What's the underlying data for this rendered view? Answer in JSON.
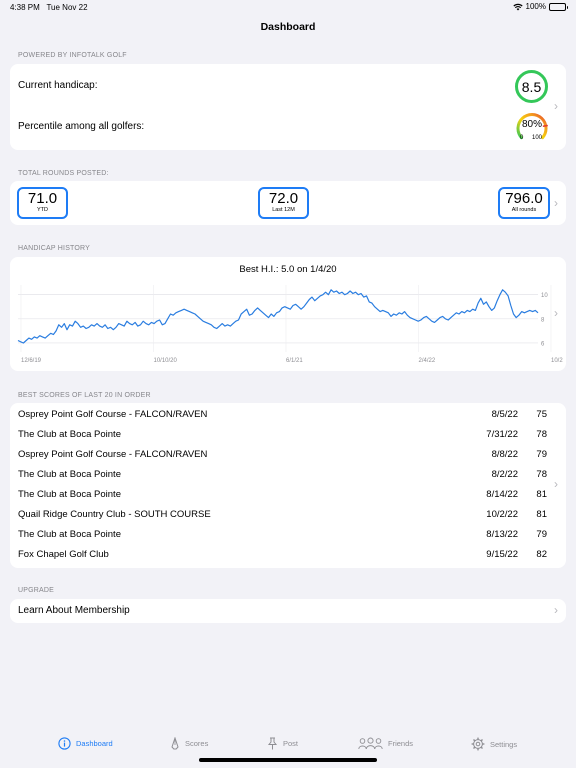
{
  "status_bar": {
    "time": "4:38 PM",
    "date": "Tue Nov 22",
    "battery": "100%"
  },
  "nav": {
    "title": "Dashboard"
  },
  "handicap_section": {
    "header": "POWERED BY INFOTALK GOLF",
    "current_label": "Current handicap:",
    "current_value": "8.5",
    "percentile_label": "Percentile among all golfers:",
    "percentile_value": "80%",
    "percentile_fraction": 0.8,
    "gauge_min": "0",
    "gauge_max": "100"
  },
  "rounds_section": {
    "header": "TOTAL ROUNDS POSTED:",
    "boxes": [
      {
        "value": "71.0",
        "label": "YTD"
      },
      {
        "value": "72.0",
        "label": "Last 12M"
      },
      {
        "value": "796.0",
        "label": "All rounds"
      }
    ]
  },
  "history_section": {
    "header": "HANDICAP HISTORY"
  },
  "chart_data": {
    "type": "line",
    "title": "Best H.I.: 5.0 on 1/4/20",
    "x_ticks": [
      "12/6/19",
      "10/10/20",
      "6/1/21",
      "2/4/22",
      "10/2"
    ],
    "y_ticks": [
      "10",
      "8",
      "6"
    ],
    "ylim": [
      5.5,
      10.8
    ],
    "grid": "horizontal",
    "series": [
      {
        "values": [
          6.2,
          6.1,
          6.0,
          6.2,
          6.4,
          6.3,
          6.5,
          6.4,
          6.6,
          6.5,
          6.4,
          6.6,
          6.8,
          6.7,
          7.0,
          7.5,
          7.3,
          7.6,
          7.1,
          7.5,
          7.4,
          7.8,
          7.6,
          7.3,
          7.4,
          7.2,
          7.3,
          7.5,
          7.4,
          7.6,
          7.4,
          7.3,
          7.5,
          7.2,
          7.3,
          7.1,
          7.3,
          7.6,
          7.5,
          7.4,
          7.8,
          7.6,
          7.5,
          7.7,
          7.4,
          7.5,
          7.8,
          7.6,
          7.5,
          7.7,
          7.6,
          7.8,
          7.9,
          7.5,
          7.6,
          8.0,
          8.4,
          8.3,
          8.5,
          8.6,
          8.7,
          8.8,
          8.7,
          8.6,
          8.5,
          8.4,
          8.2,
          8.0,
          7.8,
          7.7,
          7.6,
          7.5,
          7.3,
          7.2,
          7.4,
          7.6,
          7.4,
          7.5,
          7.4,
          7.6,
          7.8,
          7.9,
          8.4,
          8.6,
          8.8,
          8.3,
          8.4,
          8.7,
          8.9,
          8.7,
          8.5,
          8.3,
          8.1,
          8.4,
          8.2,
          8.5,
          8.6,
          8.9,
          9.0,
          8.9,
          8.8,
          9.1,
          9.2,
          9.0,
          8.8,
          9.0,
          9.3,
          9.6,
          9.8,
          9.5,
          9.7,
          9.9,
          10.0,
          10.2,
          10.0,
          10.4,
          10.2,
          10.3,
          10.1,
          10.2,
          10.0,
          10.1,
          10.3,
          10.1,
          10.2,
          10.0,
          10.1,
          9.8,
          9.9,
          9.4,
          9.3,
          9.0,
          8.8,
          8.6,
          8.7,
          8.6,
          8.5,
          8.2,
          8.4,
          8.3,
          8.5,
          8.4,
          8.6,
          8.3,
          8.1,
          8.0,
          7.9,
          7.8,
          7.9,
          8.1,
          8.2,
          8.0,
          7.8,
          7.7,
          7.9,
          8.1,
          8.2,
          8.0,
          7.9,
          8.1,
          8.3,
          8.5,
          8.4,
          8.6,
          8.5,
          8.7,
          8.6,
          8.8,
          8.7,
          9.3,
          9.7,
          9.2,
          9.4,
          9.0,
          8.7,
          8.9,
          9.5,
          10.0,
          10.4,
          10.2,
          9.9,
          9.1,
          8.4,
          8.1,
          8.3,
          8.6,
          8.5,
          8.6,
          8.7,
          8.6,
          8.7,
          8.5
        ]
      }
    ]
  },
  "scores_section": {
    "header": "BEST SCORES OF LAST 20 IN ORDER",
    "rows": [
      {
        "course": "Osprey Point Golf Course - FALCON/RAVEN",
        "date": "8/5/22",
        "score": "75"
      },
      {
        "course": "The Club at Boca Pointe",
        "date": "7/31/22",
        "score": "78"
      },
      {
        "course": "Osprey Point Golf Course - FALCON/RAVEN",
        "date": "8/8/22",
        "score": "79"
      },
      {
        "course": "The Club at Boca Pointe",
        "date": "8/2/22",
        "score": "78"
      },
      {
        "course": "The Club at Boca Pointe",
        "date": "8/14/22",
        "score": "81"
      },
      {
        "course": "Quail Ridge Country Club - SOUTH COURSE",
        "date": "10/2/22",
        "score": "81"
      },
      {
        "course": "The Club at Boca Pointe",
        "date": "8/13/22",
        "score": "79"
      },
      {
        "course": "Fox Chapel Golf Club",
        "date": "9/15/22",
        "score": "82"
      }
    ]
  },
  "upgrade_section": {
    "header": "UPGRADE",
    "link_label": "Learn About Membership"
  },
  "tab_bar": {
    "tabs": [
      {
        "label": "Dashboard",
        "icon": "info-icon",
        "active": true
      },
      {
        "label": "Scores",
        "icon": "pen-icon",
        "active": false
      },
      {
        "label": "Post",
        "icon": "pin-icon",
        "active": false
      },
      {
        "label": "Friends",
        "icon": "people-icon",
        "active": false
      },
      {
        "label": "Settings",
        "icon": "gear-icon",
        "active": false
      }
    ]
  },
  "colors": {
    "accent": "#1e7cf5",
    "handicap_ring": "#34c759",
    "chart_line": "#2a7de0",
    "background": "#f2f2f7"
  }
}
